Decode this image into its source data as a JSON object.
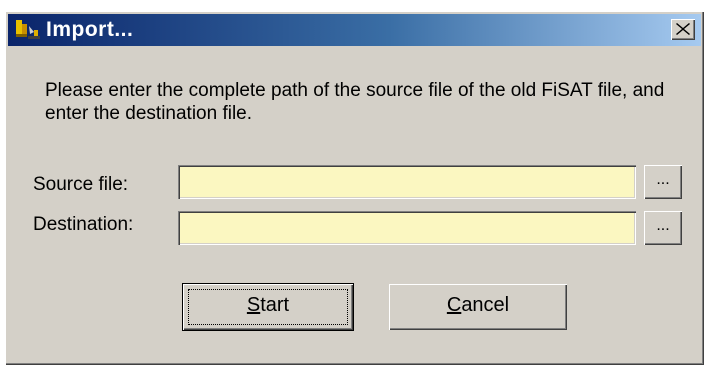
{
  "window": {
    "title": "Import...",
    "icon": "fisat-app-icon",
    "close_icon": "close-icon"
  },
  "instructions": "Please enter the complete path of the source file of the old FiSAT file, and enter the destination file.",
  "fields": [
    {
      "label": "Source file:",
      "value": "",
      "browse_label": "..."
    },
    {
      "label": "Destination:",
      "value": "",
      "browse_label": "..."
    }
  ],
  "buttons": {
    "start": {
      "mnemonic": "S",
      "rest": "tart"
    },
    "cancel": {
      "mnemonic": "C",
      "rest": "ancel"
    }
  },
  "colors": {
    "title_gradient_start": "#0a246a",
    "title_gradient_end": "#a6caf0",
    "input_background": "#fbf7c1",
    "dialog_background": "#d4d0c8"
  }
}
